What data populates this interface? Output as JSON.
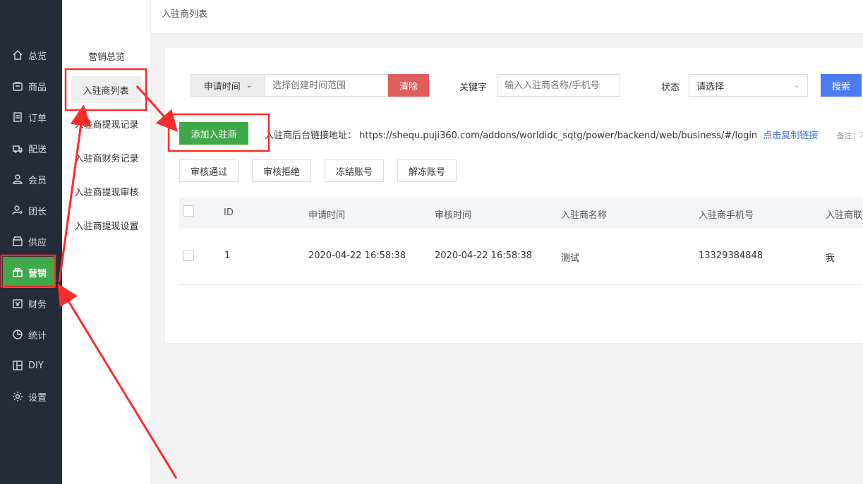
{
  "sidebar": {
    "items": [
      {
        "label": "总览",
        "icon": "home-icon"
      },
      {
        "label": "商品",
        "icon": "bag-icon"
      },
      {
        "label": "订单",
        "icon": "order-icon"
      },
      {
        "label": "配送",
        "icon": "delivery-icon"
      },
      {
        "label": "会员",
        "icon": "user-icon"
      },
      {
        "label": "团长",
        "icon": "leader-icon"
      },
      {
        "label": "供应",
        "icon": "supply-icon"
      },
      {
        "label": "营销",
        "icon": "gift-icon",
        "active": true
      },
      {
        "label": "财务",
        "icon": "finance-icon"
      },
      {
        "label": "统计",
        "icon": "pie-chart-icon"
      },
      {
        "label": "DIY",
        "icon": "layout-icon"
      },
      {
        "label": "设置",
        "icon": "gear-icon"
      }
    ]
  },
  "subnav": {
    "items": [
      {
        "label": "营销总览"
      },
      {
        "label": "入驻商列表",
        "active": true
      },
      {
        "label": "入驻商提现记录"
      },
      {
        "label": "入驻商财务记录"
      },
      {
        "label": "入驻商提现审核"
      },
      {
        "label": "入驻商提现设置"
      }
    ]
  },
  "header": {
    "breadcrumb": "入驻商列表"
  },
  "filter": {
    "time_type": "申请时间",
    "range_placeholder": "选择创建时间范围",
    "clear_label": "清除",
    "keyword_label": "关键字",
    "keyword_placeholder": "输入入驻商名称/手机号",
    "status_label": "状态",
    "status_value": "请选择",
    "search_label": "搜索"
  },
  "toolbar": {
    "add_label": "添加入驻商",
    "link_label": "入驻商后台链接地址：",
    "link_url": "https://shequ.puji360.com/addons/worldidc_sqtg/power/backend/web/business/#/login",
    "copy_label": "点击复制链接",
    "note": "备注：不可",
    "actions": [
      "审核通过",
      "审核拒绝",
      "冻结账号",
      "解冻账号"
    ]
  },
  "table": {
    "headers": [
      "ID",
      "申请时间",
      "审核时间",
      "入驻商名称",
      "入驻商手机号",
      "入驻商联"
    ],
    "rows": [
      {
        "id": "1",
        "apply_time": "2020-04-22 16:58:38",
        "review_time": "2020-04-22 16:58:38",
        "name": "测试",
        "phone": "13329384848",
        "contact": "我"
      }
    ]
  },
  "colors": {
    "accent_green": "#3fa84a",
    "primary_blue": "#4a7cf0",
    "danger_red": "#e05d5d",
    "annotation_red": "#ff2a2a",
    "sidebar_bg": "#262b3a"
  }
}
